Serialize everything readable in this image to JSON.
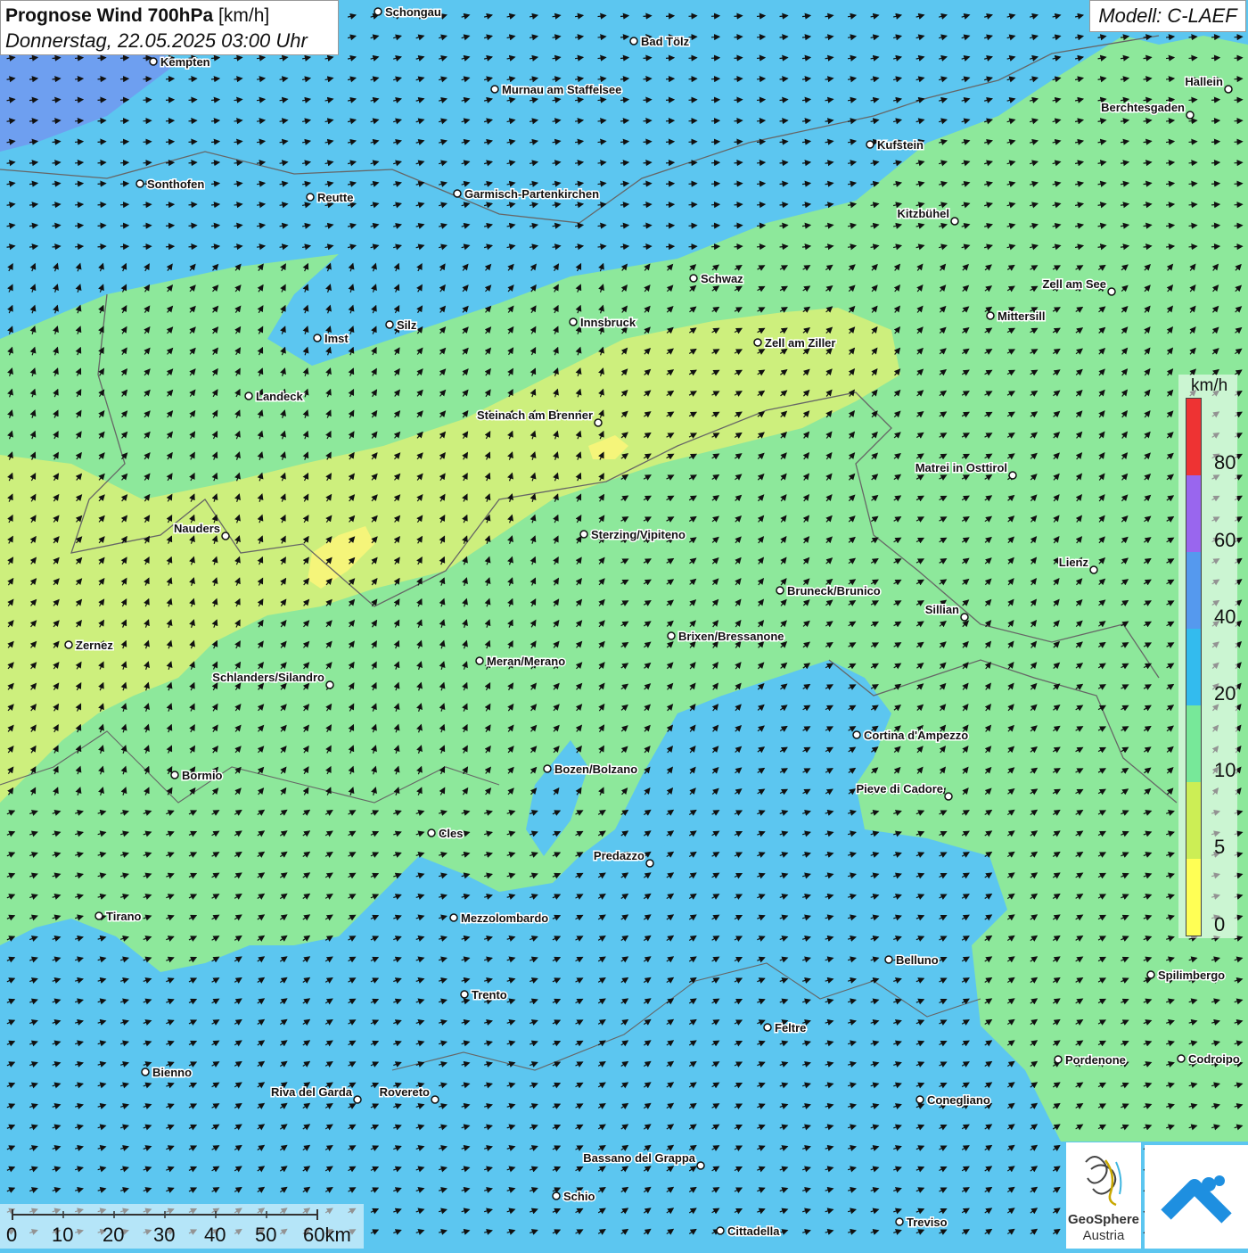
{
  "header": {
    "title_bold": "Prognose Wind 700hPa",
    "title_unit": "[km/h]",
    "datetime": "Donnerstag, 22.05.2025 03:00 Uhr"
  },
  "model": "Modell: C-LAEF",
  "legend": {
    "unit": "km/h",
    "ticks": [
      "80",
      "60",
      "40",
      "20",
      "10",
      "5",
      "0"
    ],
    "colors": [
      "#ee3333",
      "#9966ee",
      "#5599ee",
      "#33bbee",
      "#77e899",
      "#ccee55",
      "#ffff55"
    ]
  },
  "scalebar": {
    "labels": [
      "0",
      "10",
      "20",
      "30",
      "40",
      "50",
      "60km"
    ]
  },
  "logos": {
    "geosphere_line1": "GeoSphere",
    "geosphere_line2": "Austria"
  },
  "cities": [
    {
      "name": "Schongau"
    },
    {
      "name": "Bad Tölz"
    },
    {
      "name": "Kempten"
    },
    {
      "name": "Hallein"
    },
    {
      "name": "Murnau am Staffelsee"
    },
    {
      "name": "Berchtesgaden"
    },
    {
      "name": "Kufstein"
    },
    {
      "name": "Sonthofen"
    },
    {
      "name": "Reutte"
    },
    {
      "name": "Garmisch-Partenkirchen"
    },
    {
      "name": "Kitzbühel"
    },
    {
      "name": "Schwaz"
    },
    {
      "name": "Zell am See"
    },
    {
      "name": "Mittersill"
    },
    {
      "name": "Innsbruck"
    },
    {
      "name": "Imst"
    },
    {
      "name": "Silz"
    },
    {
      "name": "Zell am Ziller"
    },
    {
      "name": "Landeck"
    },
    {
      "name": "Steinach am Brenner"
    },
    {
      "name": "Matrei in Osttirol"
    },
    {
      "name": "Nauders"
    },
    {
      "name": "Sterzing/Vipiteno"
    },
    {
      "name": "Lienz"
    },
    {
      "name": "Bruneck/Brunico"
    },
    {
      "name": "Sillian"
    },
    {
      "name": "Brixen/Bressanone"
    },
    {
      "name": "Zernez"
    },
    {
      "name": "Meran/Merano"
    },
    {
      "name": "Schlanders/Silandro"
    },
    {
      "name": "Cortina d'Ampezzo"
    },
    {
      "name": "Bozen/Bolzano"
    },
    {
      "name": "Bormio"
    },
    {
      "name": "Pieve di Cadore"
    },
    {
      "name": "Cles"
    },
    {
      "name": "Predazzo"
    },
    {
      "name": "Tirano"
    },
    {
      "name": "Mezzolombardo"
    },
    {
      "name": "Belluno"
    },
    {
      "name": "Spilimbergo"
    },
    {
      "name": "Trento"
    },
    {
      "name": "Feltre"
    },
    {
      "name": "Pordenone"
    },
    {
      "name": "Codroipo"
    },
    {
      "name": "Bienno"
    },
    {
      "name": "Riva del Garda"
    },
    {
      "name": "Rovereto"
    },
    {
      "name": "Conegliano"
    },
    {
      "name": "Bassano del Grappa"
    },
    {
      "name": "Schio"
    },
    {
      "name": "Treviso"
    },
    {
      "name": "Cittadella"
    }
  ]
}
